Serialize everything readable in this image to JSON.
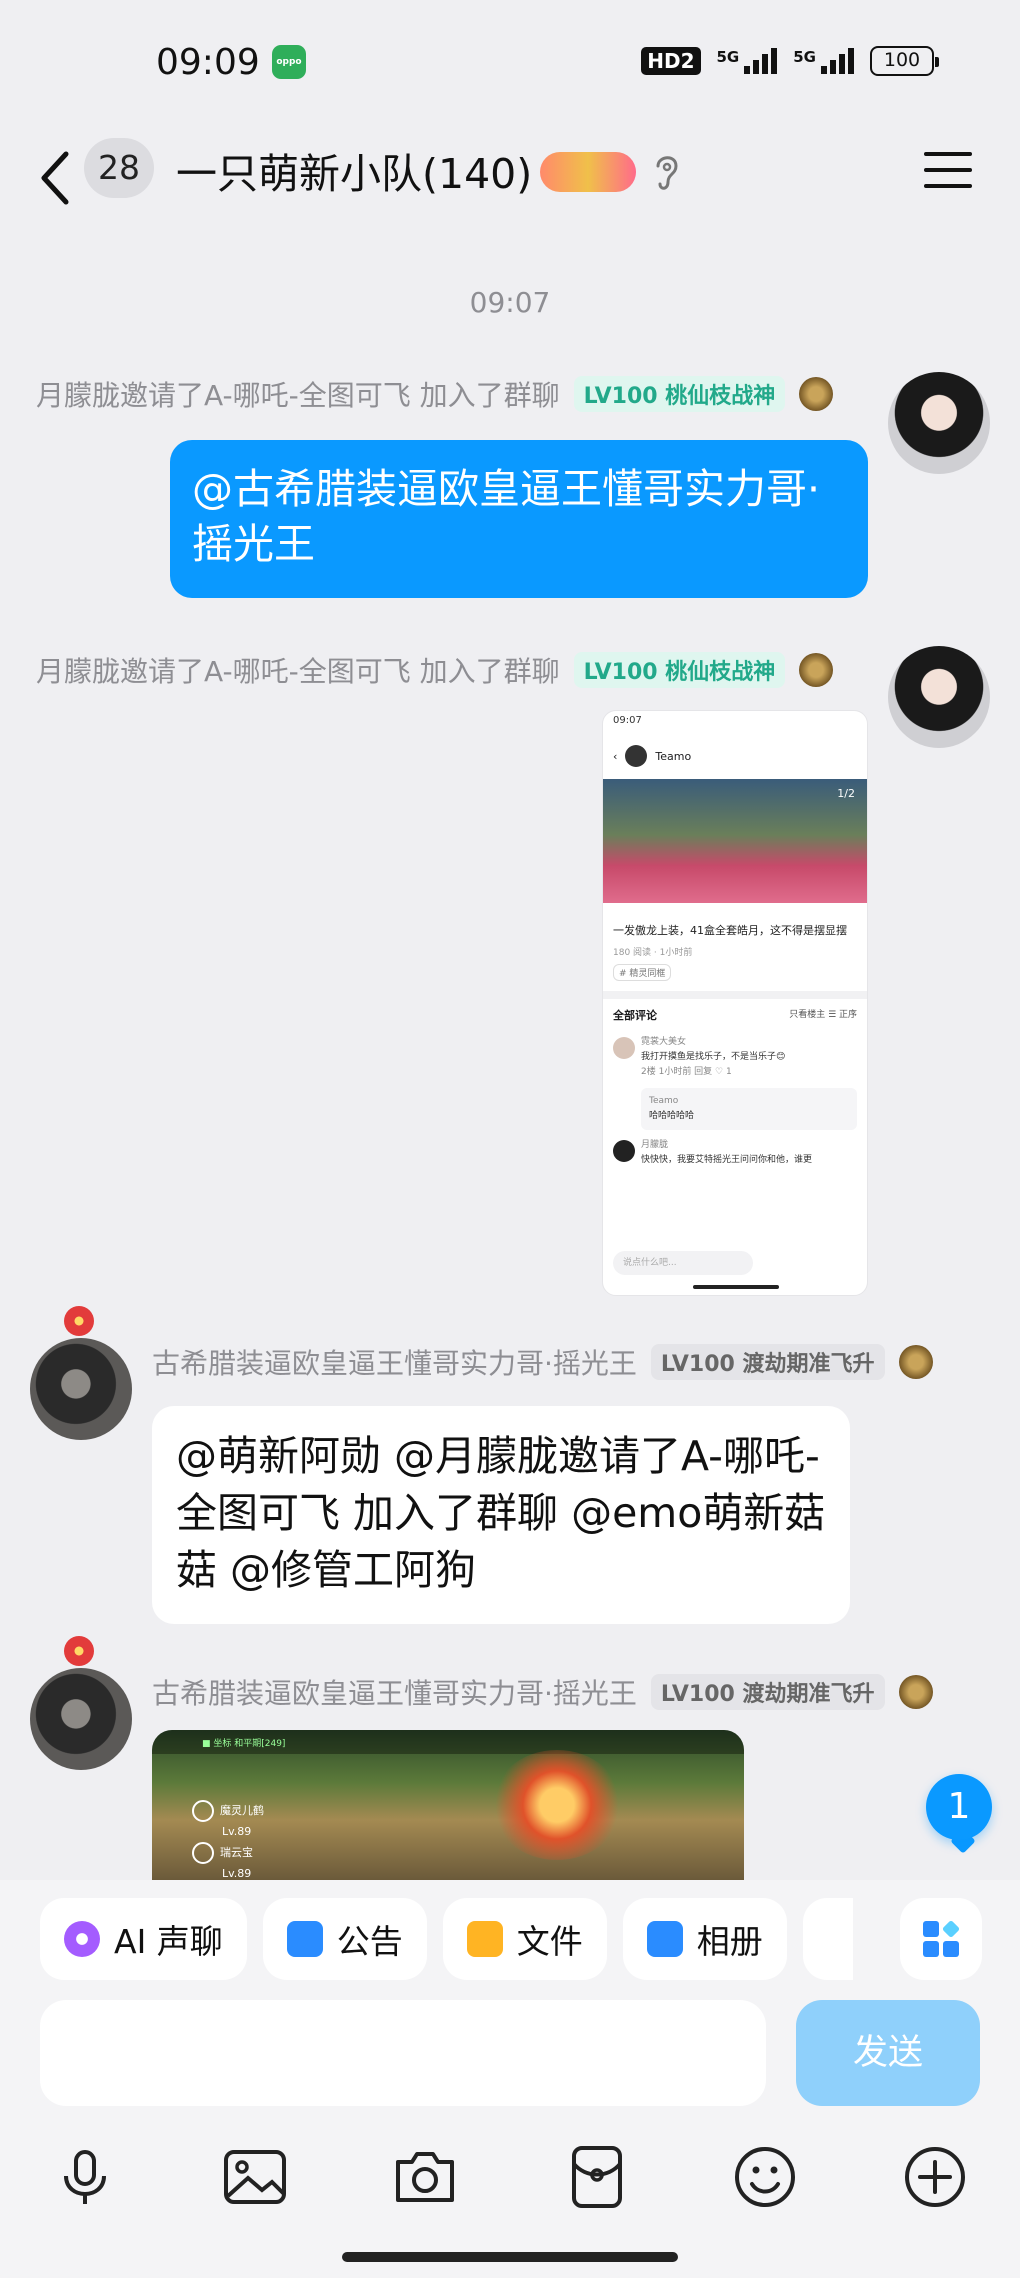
{
  "status_bar": {
    "time": "09:09",
    "app_badge": "oppo",
    "hd_label": "HD2",
    "signal1_label": "5G",
    "signal2_label": "5G",
    "battery": "100"
  },
  "header": {
    "unread_count": "28",
    "title": "一只萌新小队(140)",
    "title_decoration": "",
    "icons": [
      "back-icon",
      "ear-icon",
      "menu-icon"
    ]
  },
  "timestamp": "09:07",
  "messages": [
    {
      "sender": "月朦胧邀请了A-哪吒-全图可飞  加入了群聊",
      "level": "LV100 桃仙枝战神",
      "content": "@古希腊装逼欧皇逼王懂哥实力哥·摇光王"
    },
    {
      "sender": "月朦胧邀请了A-哪吒-全图可飞  加入了群聊",
      "level": "LV100 桃仙枝战神",
      "image": {
        "time": "09:07",
        "nav_name": "Teamo",
        "page": "1/2",
        "post_text": "一发傲龙上装，41盒全套皓月，这不得是摆显摆",
        "meta": "180 阅读 · 1小时前",
        "tag": "# 精灵同框",
        "comments_title": "全部评论",
        "comments_option": "只看楼主  ☰ 正序",
        "comments": [
          {
            "name": "霓裳大美女",
            "text": "我打开摸鱼是找乐子，不是当乐子😊",
            "meta": "2楼  1小时前    回复  ♡ 1"
          },
          {
            "name": "月朦胧",
            "text": "快快快，我要艾特摇光王问问你和他，谁更"
          }
        ],
        "reply": {
          "name": "Teamo",
          "text": "哈哈哈哈哈"
        },
        "input_placeholder": "说点什么吧..."
      }
    },
    {
      "sender": "古希腊装逼欧皇逼王懂哥实力哥·摇光王",
      "level": "LV100 渡劫期准飞升",
      "content": "@萌新阿勋 @月朦胧邀请了A-哪吒-全图可飞  加入了群聊 @emo萌新菇菇 @修管工阿狗"
    },
    {
      "sender": "古希腊装逼欧皇逼王懂哥实力哥·摇光王",
      "level": "LV100 渡劫期准飞升",
      "image": {
        "hud_top": "■ 坐标  和平期[249]",
        "hud1_name": "魔灵儿鹤",
        "hud1_lv": "Lv.89",
        "hud2_name": "瑞云宝",
        "hud2_lv": "Lv.89"
      }
    }
  ],
  "unread_fab": "1",
  "quick_actions": [
    {
      "label": "AI 声聊",
      "icon": "ai-voice-icon"
    },
    {
      "label": "公告",
      "icon": "notice-icon"
    },
    {
      "label": "文件",
      "icon": "folder-icon"
    },
    {
      "label": "相册",
      "icon": "album-icon"
    }
  ],
  "input": {
    "placeholder": "",
    "send_label": "发送"
  },
  "toolbar": [
    "mic-icon",
    "image-icon",
    "camera-icon",
    "red-packet-icon",
    "emoji-icon",
    "plus-icon"
  ],
  "colors": {
    "accent": "#0a99ff",
    "send_disabled": "#8fd0fb",
    "level_green": "#22a98a"
  }
}
